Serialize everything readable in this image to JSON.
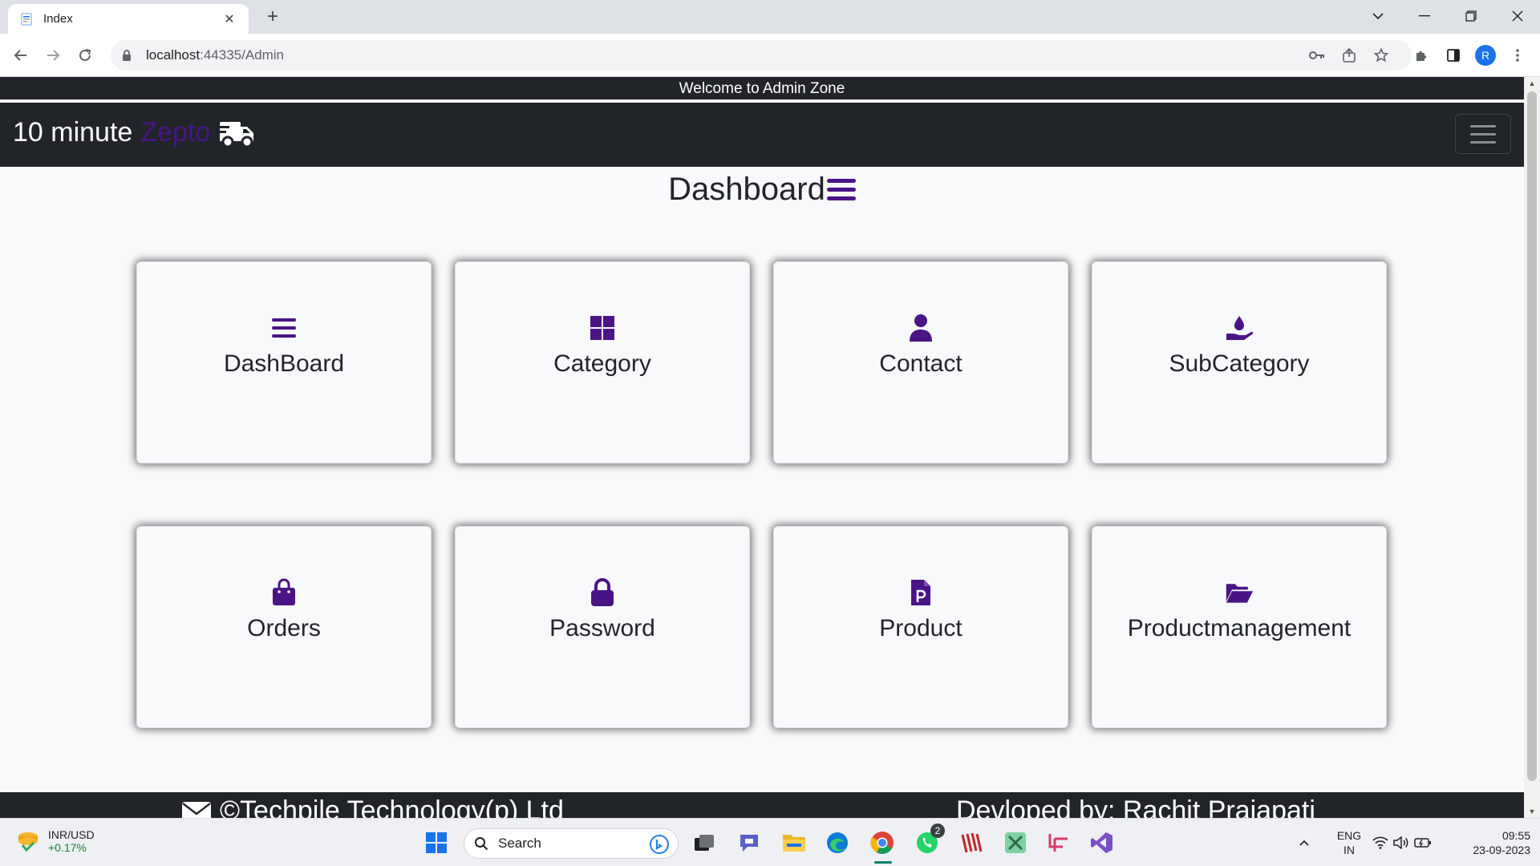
{
  "browser": {
    "tab_title": "Index",
    "url_host": "localhost",
    "url_rest": ":44335/Admin",
    "profile_initial": "R"
  },
  "page": {
    "welcome_text": "Welcome to Admin Zone",
    "brand_main": "10 minute",
    "brand_accent": "Zepto",
    "dashboard_title": "Dashboard",
    "accent_color": "#4a1486",
    "cards": [
      {
        "label": "DashBoard",
        "icon": "bars-icon"
      },
      {
        "label": "Category",
        "icon": "windows-grid-icon"
      },
      {
        "label": "Contact",
        "icon": "user-icon"
      },
      {
        "label": "SubCategory",
        "icon": "hand-holding-droplet-icon"
      },
      {
        "label": "Orders",
        "icon": "shopping-bag-icon"
      },
      {
        "label": "Password",
        "icon": "lock-icon"
      },
      {
        "label": "Product",
        "icon": "file-p-icon"
      },
      {
        "label": "Productmanagement",
        "icon": "folder-open-icon"
      }
    ],
    "footer_left": "©Techpile Technology(p) Ltd",
    "footer_right": "Devloped by: Rachit Prajapati"
  },
  "taskbar": {
    "widget_label": "INR/USD",
    "widget_value": "+0.17%",
    "search_label": "Search",
    "whatsapp_badge": "2",
    "lang_top": "ENG",
    "lang_bottom": "IN",
    "time": "09:55",
    "date": "23-09-2023"
  }
}
